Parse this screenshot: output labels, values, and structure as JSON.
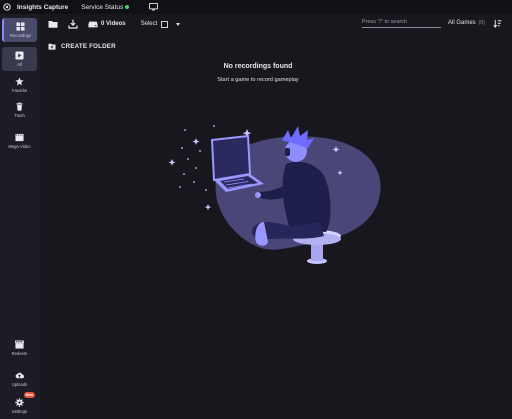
{
  "topbar": {
    "app_title": "Insights Capture",
    "service_status": "Service Status",
    "status_color": "#3fd16a"
  },
  "sidebar": {
    "items": [
      {
        "label": "Recordings",
        "icon": "grid-icon"
      },
      {
        "label": "All",
        "icon": "play-icon"
      },
      {
        "label": "Favorite",
        "icon": "star-icon"
      },
      {
        "label": "Trash",
        "icon": "trash-icon"
      },
      {
        "label": "Mega Video",
        "icon": "film-icon"
      },
      {
        "label": "Redeem",
        "icon": "clapper-icon"
      },
      {
        "label": "Uploads",
        "icon": "cloud-upload-icon"
      },
      {
        "label": "Settings",
        "icon": "gear-icon",
        "badge": "New"
      }
    ]
  },
  "toolbar": {
    "videos_label": "0 Videos",
    "select_label": "Select",
    "search_placeholder": "Press \"/\" to search",
    "games_filter": "All Games",
    "games_count": "(0)"
  },
  "main": {
    "create_folder": "CREATE FOLDER",
    "empty_title": "No recordings found",
    "empty_subtitle": "Start a game to record gameplay"
  },
  "colors": {
    "accent": "#8a8aff",
    "illustration_blob": "#4a4678",
    "character_blue": "#7a7aff"
  }
}
